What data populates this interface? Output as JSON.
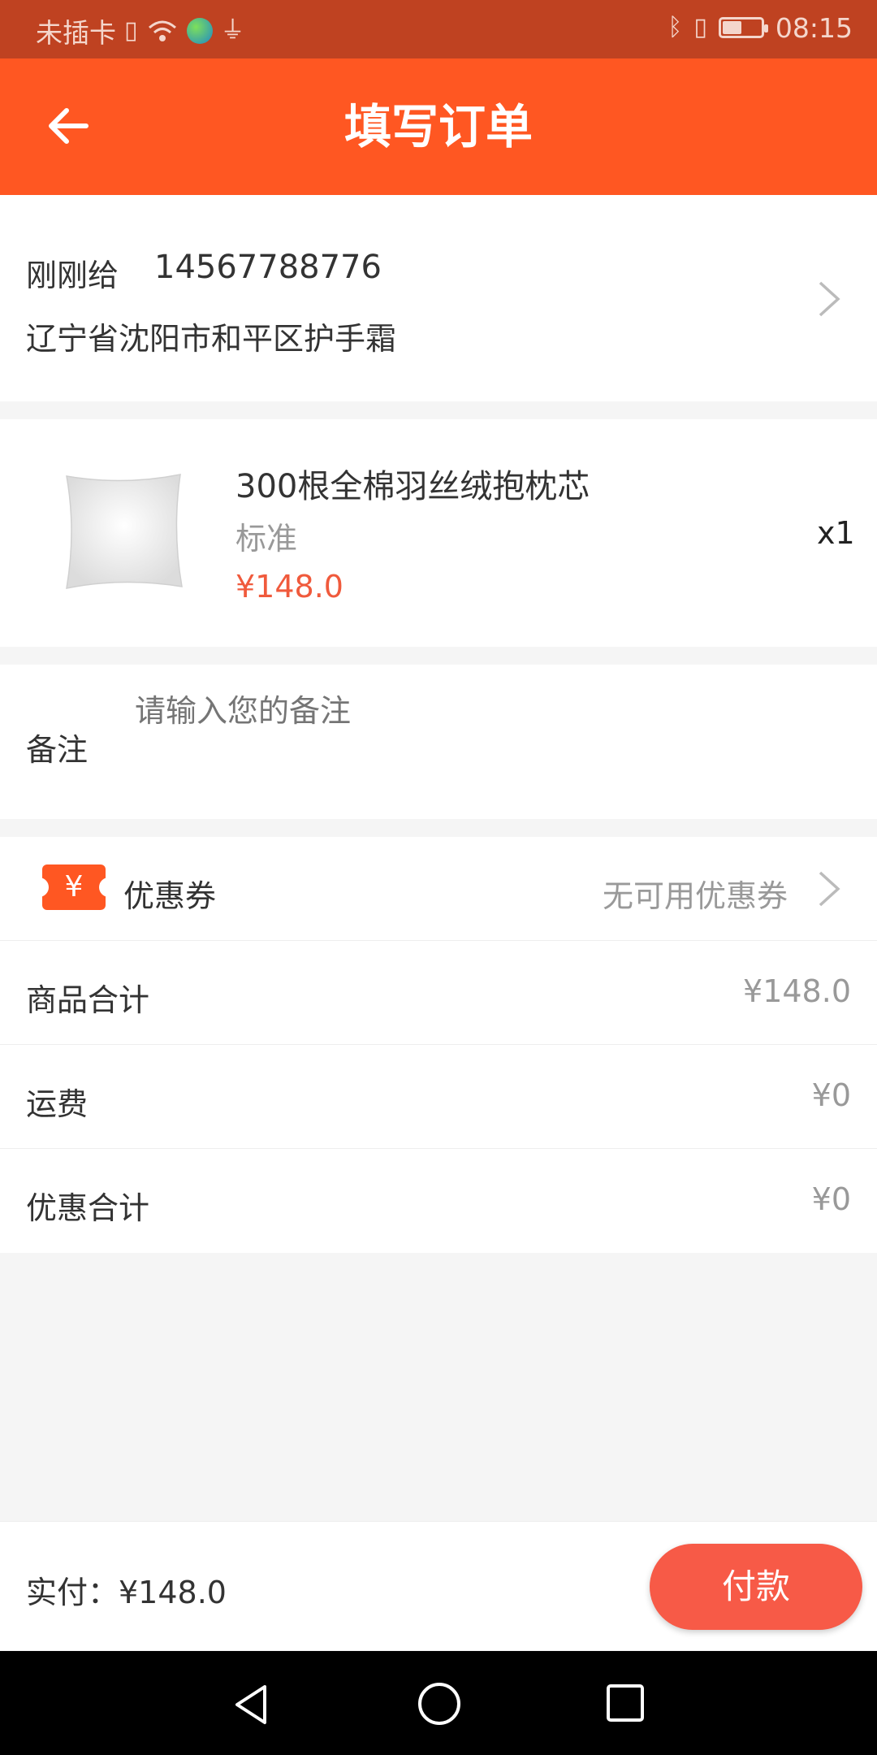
{
  "status_bar": {
    "carrier": "未插卡",
    "time": "08:15",
    "battery_level": 0.5
  },
  "app_bar": {
    "title": "填写订单"
  },
  "address": {
    "name": "刚刚给",
    "phone": "14567788776",
    "detail": "辽宁省沈阳市和平区护手霜"
  },
  "product": {
    "name": "300根全棉羽丝绒抱枕芯",
    "spec": "标准",
    "price": "¥148.0",
    "quantity": "x1"
  },
  "remark": {
    "label": "备注",
    "placeholder": "请输入您的备注"
  },
  "coupon": {
    "icon_glyph": "¥",
    "label": "优惠券",
    "value": "无可用优惠券"
  },
  "summary": {
    "rows": [
      {
        "label": "商品合计",
        "value": "¥148.0"
      },
      {
        "label": "运费",
        "value": "¥0"
      },
      {
        "label": "优惠合计",
        "value": "¥0"
      }
    ]
  },
  "footer": {
    "total_label": "实付：¥148.0",
    "pay_button": "付款"
  },
  "colors": {
    "primary": "#ff5722",
    "status_bar": "#bf4221",
    "price": "#f05a3c",
    "pay_button": "#f75a47"
  }
}
